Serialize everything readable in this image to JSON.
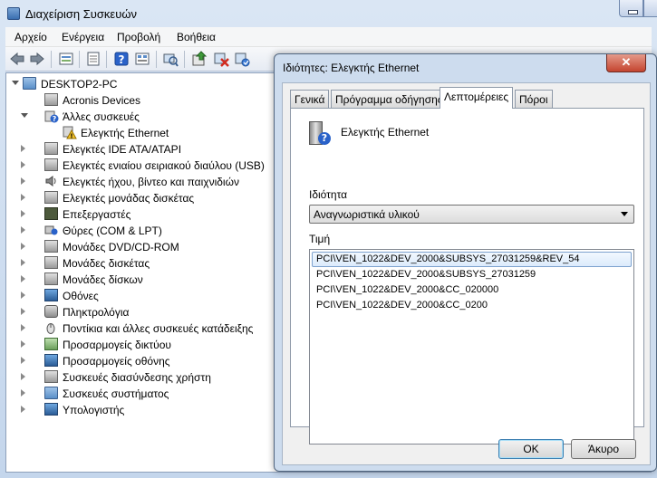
{
  "window": {
    "title": "Διαχείριση Συσκευών"
  },
  "menu": {
    "items": [
      "Αρχείο",
      "Ενέργεια",
      "Προβολή",
      "Βοήθεια"
    ]
  },
  "toolbar": {
    "buttons": [
      "back-icon",
      "forward-icon",
      "up-icon",
      "properties-icon",
      "help-icon",
      "view-icon",
      "scan-hardware-icon",
      "update-driver-icon",
      "disable-device-icon",
      "uninstall-device-icon"
    ]
  },
  "tree": {
    "root": "DESKTOP2-PC",
    "items": [
      {
        "label": "Acronis Devices",
        "icon": "gray-device-icon"
      },
      {
        "label": "Άλλες συσκευές",
        "icon": "unknown-device-icon",
        "expanded": true
      },
      {
        "label": "Ελεγκτής Ethernet",
        "icon": "warning-device-icon",
        "child": true
      },
      {
        "label": "Ελεγκτές IDE ATA/ATAPI",
        "icon": "ide-controller-icon"
      },
      {
        "label": "Ελεγκτές ενιαίου σειριακού διαύλου (USB)",
        "icon": "usb-controller-icon"
      },
      {
        "label": "Ελεγκτές ήχου, βίντεο και παιχνιδιών",
        "icon": "sound-icon"
      },
      {
        "label": "Ελεγκτές μονάδας δισκέτας",
        "icon": "floppy-controller-icon"
      },
      {
        "label": "Επεξεργαστές",
        "icon": "processor-icon"
      },
      {
        "label": "Θύρες (COM & LPT)",
        "icon": "port-icon"
      },
      {
        "label": "Μονάδες DVD/CD-ROM",
        "icon": "dvd-drive-icon"
      },
      {
        "label": "Μονάδες δισκέτας",
        "icon": "floppy-drive-icon"
      },
      {
        "label": "Μονάδες δίσκων",
        "icon": "disk-drive-icon"
      },
      {
        "label": "Οθόνες",
        "icon": "monitor-icon"
      },
      {
        "label": "Πληκτρολόγια",
        "icon": "keyboard-icon"
      },
      {
        "label": "Ποντίκια και άλλες συσκευές κατάδειξης",
        "icon": "mouse-icon"
      },
      {
        "label": "Προσαρμογείς δικτύου",
        "icon": "network-adapter-icon"
      },
      {
        "label": "Προσαρμογείς οθόνης",
        "icon": "display-adapter-icon"
      },
      {
        "label": "Συσκευές διασύνδεσης χρήστη",
        "icon": "hid-icon"
      },
      {
        "label": "Συσκευές συστήματος",
        "icon": "system-device-icon"
      },
      {
        "label": "Υπολογιστής",
        "icon": "computer-icon"
      }
    ]
  },
  "dialog": {
    "title": "Ιδιότητες: Ελεγκτής Ethernet",
    "close_glyph": "✕",
    "tabs": [
      "Γενικά",
      "Πρόγραμμα οδήγησης",
      "Λεπτομέρειες",
      "Πόροι"
    ],
    "active_tab": "Λεπτομέρειες",
    "device_name": "Ελεγκτής Ethernet",
    "property_label": "Ιδιότητα",
    "property_selected": "Αναγνωριστικά υλικού",
    "value_label": "Τιμή",
    "values": [
      "PCI\\VEN_1022&DEV_2000&SUBSYS_27031259&REV_54",
      "PCI\\VEN_1022&DEV_2000&SUBSYS_27031259",
      "PCI\\VEN_1022&DEV_2000&CC_020000",
      "PCI\\VEN_1022&DEV_2000&CC_0200"
    ],
    "ok_label": "OK",
    "cancel_label": "Άκυρο"
  },
  "colors": {
    "window_frame": "#c4d6ec",
    "dialog_frame": "#cddcee",
    "selection_border": "#7da2ce",
    "close_red": "#c4442f"
  }
}
